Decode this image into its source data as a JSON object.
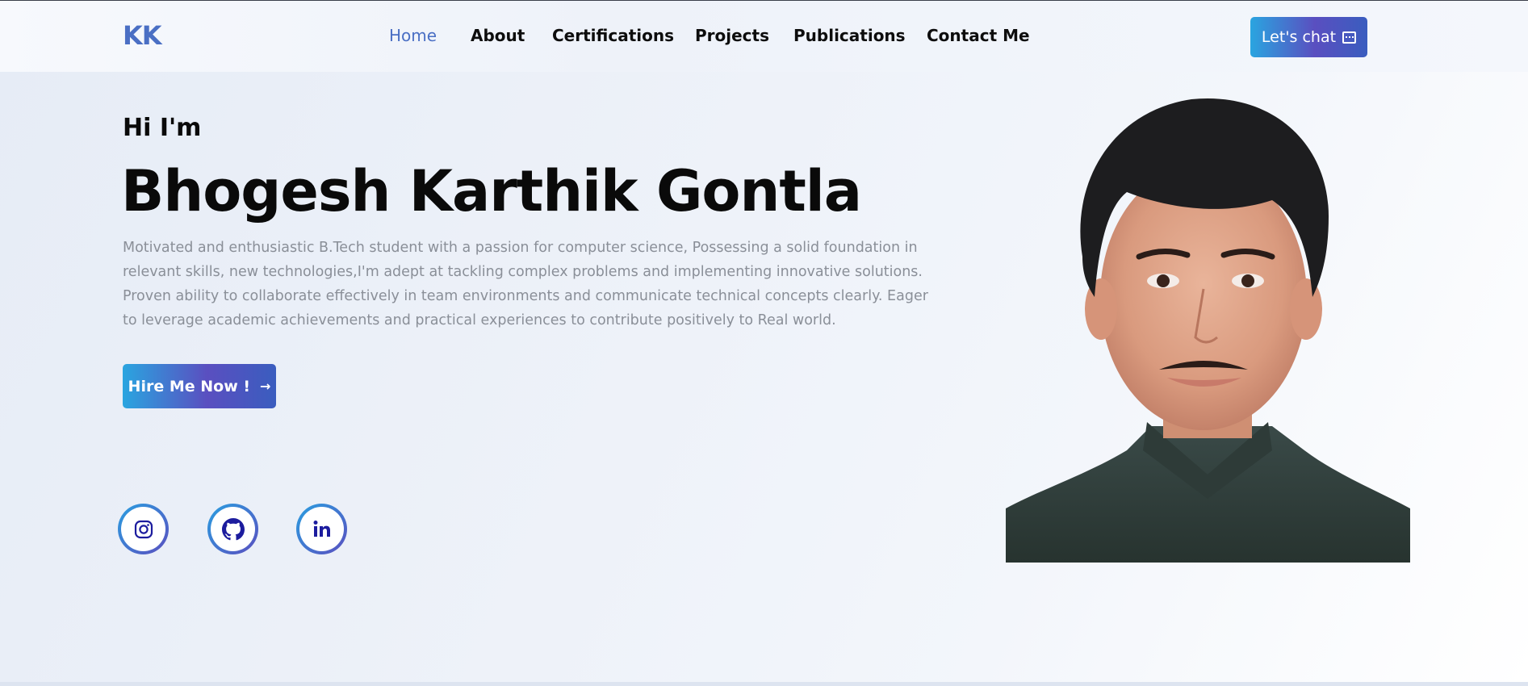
{
  "header": {
    "logo": "KK",
    "nav": [
      {
        "label": "Home",
        "active": true
      },
      {
        "label": "About",
        "active": false
      },
      {
        "label": "Certifications",
        "active": false
      },
      {
        "label": "Projects",
        "active": false
      },
      {
        "label": "Publications",
        "active": false
      },
      {
        "label": "Contact Me",
        "active": false
      }
    ],
    "chat_button": {
      "label": "Let's chat",
      "icon": "chat-bubble-icon"
    }
  },
  "hero": {
    "greeting": "Hi I'm",
    "name": "Bhogesh Karthik Gontla",
    "bio": "Motivated and enthusiastic B.Tech student with a passion for computer science, Possessing a solid foundation in relevant skills, new technologies,I'm adept at tackling complex problems and implementing innovative solutions. Proven ability to collaborate effectively in team environments and communicate technical concepts clearly. Eager to leverage academic achievements and practical experiences to contribute positively to Real world.",
    "hire_button": {
      "label": "Hire Me Now !",
      "icon": "arrow-right-icon"
    }
  },
  "social": [
    {
      "name": "instagram",
      "icon": "instagram-icon"
    },
    {
      "name": "github",
      "icon": "github-icon"
    },
    {
      "name": "linkedin",
      "icon": "linkedin-icon"
    }
  ],
  "colors": {
    "accent": "#4a6fc4",
    "gradient_start": "#2aa5e0",
    "gradient_end": "#5a4fc0",
    "bio_text": "#8a8f98"
  }
}
